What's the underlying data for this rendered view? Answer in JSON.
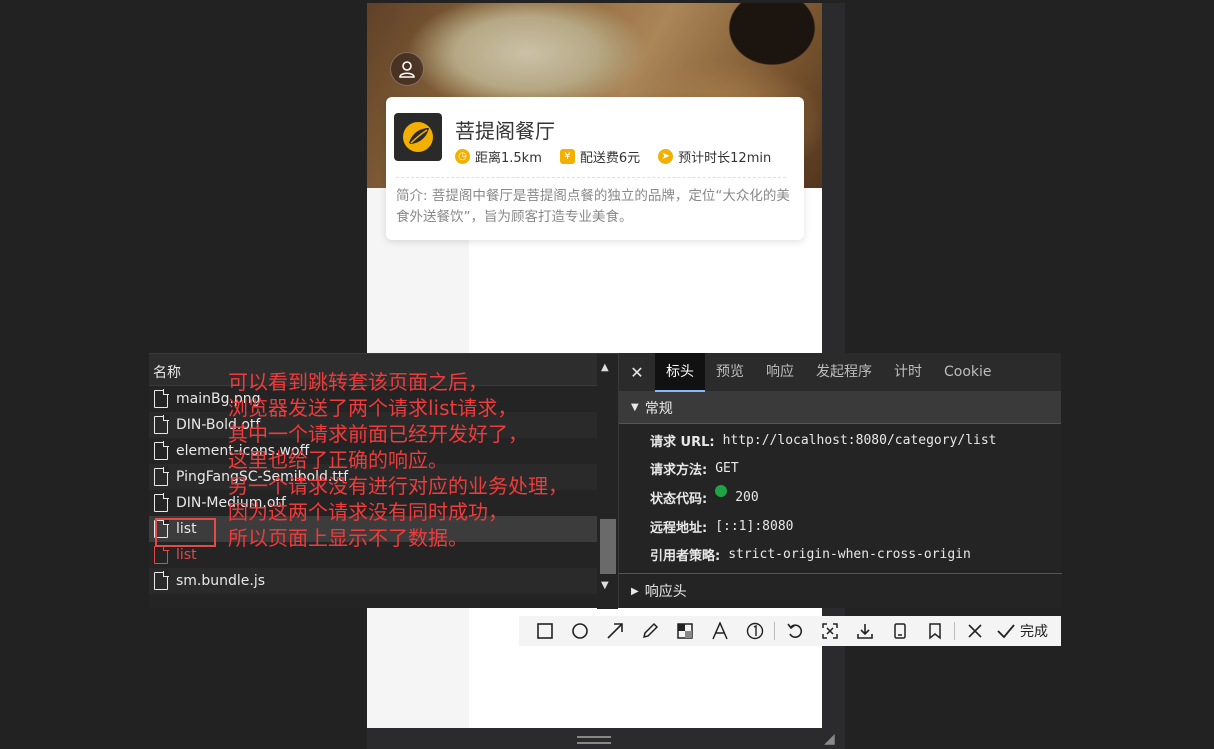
{
  "shop": {
    "name": "菩提阁餐厅",
    "distance": "距离1.5km",
    "delivery_fee": "配送费6元",
    "eta": "预计时长12min",
    "description": "简介: 菩提阁中餐厅是菩提阁点餐的独立的品牌，定位“大众化的美食外送餐饮”，旨为顾客打造专业美食。"
  },
  "network": {
    "column_header": "名称",
    "rows": [
      {
        "name": "mainBg.png",
        "status": "ok"
      },
      {
        "name": "DIN-Bold.otf",
        "status": "ok"
      },
      {
        "name": "element-icons.woff",
        "status": "ok"
      },
      {
        "name": "PingFangSC-Semibold.ttf",
        "status": "ok"
      },
      {
        "name": "DIN-Medium.otf",
        "status": "ok"
      },
      {
        "name": "list",
        "status": "selected"
      },
      {
        "name": "list",
        "status": "error"
      },
      {
        "name": "sm.bundle.js",
        "status": "ok"
      }
    ]
  },
  "annotation": [
    "可以看到跳转套该页面之后，",
    "浏览器发送了两个请求list请求，",
    "其中一个请求前面已经开发好了，",
    "这里也给了正确的响应。",
    "另一个请求没有进行对应的业务处理，",
    "因为这两个请求没有同时成功，",
    "所以页面上显示不了数据。"
  ],
  "detail": {
    "tabs": [
      "标头",
      "预览",
      "响应",
      "发起程序",
      "计时",
      "Cookie"
    ],
    "active_tab": "标头",
    "general_label": "常规",
    "request_url_label": "请求 URL:",
    "request_url": "http://localhost:8080/category/list",
    "method_label": "请求方法:",
    "method": "GET",
    "status_label": "状态代码:",
    "status": "200",
    "remote_label": "远程地址:",
    "remote": "[::1]:8080",
    "referrer_label": "引用者策略:",
    "referrer": "strict-origin-when-cross-origin",
    "response_headers_label": "响应头"
  },
  "toolbar": {
    "done_label": "完成",
    "icons": [
      "rectangle-icon",
      "circle-icon",
      "arrow-icon",
      "pen-icon",
      "mosaic-icon",
      "text-icon",
      "number-icon",
      "undo-icon",
      "ocr-icon",
      "download-icon",
      "pin-icon",
      "bookmark-icon",
      "close-icon",
      "check-icon"
    ]
  },
  "colors": {
    "annotation": "#ef3b3b",
    "error_row": "#e34a4a",
    "status_ok": "#1ea446",
    "meta_icon": "#f3b000"
  }
}
